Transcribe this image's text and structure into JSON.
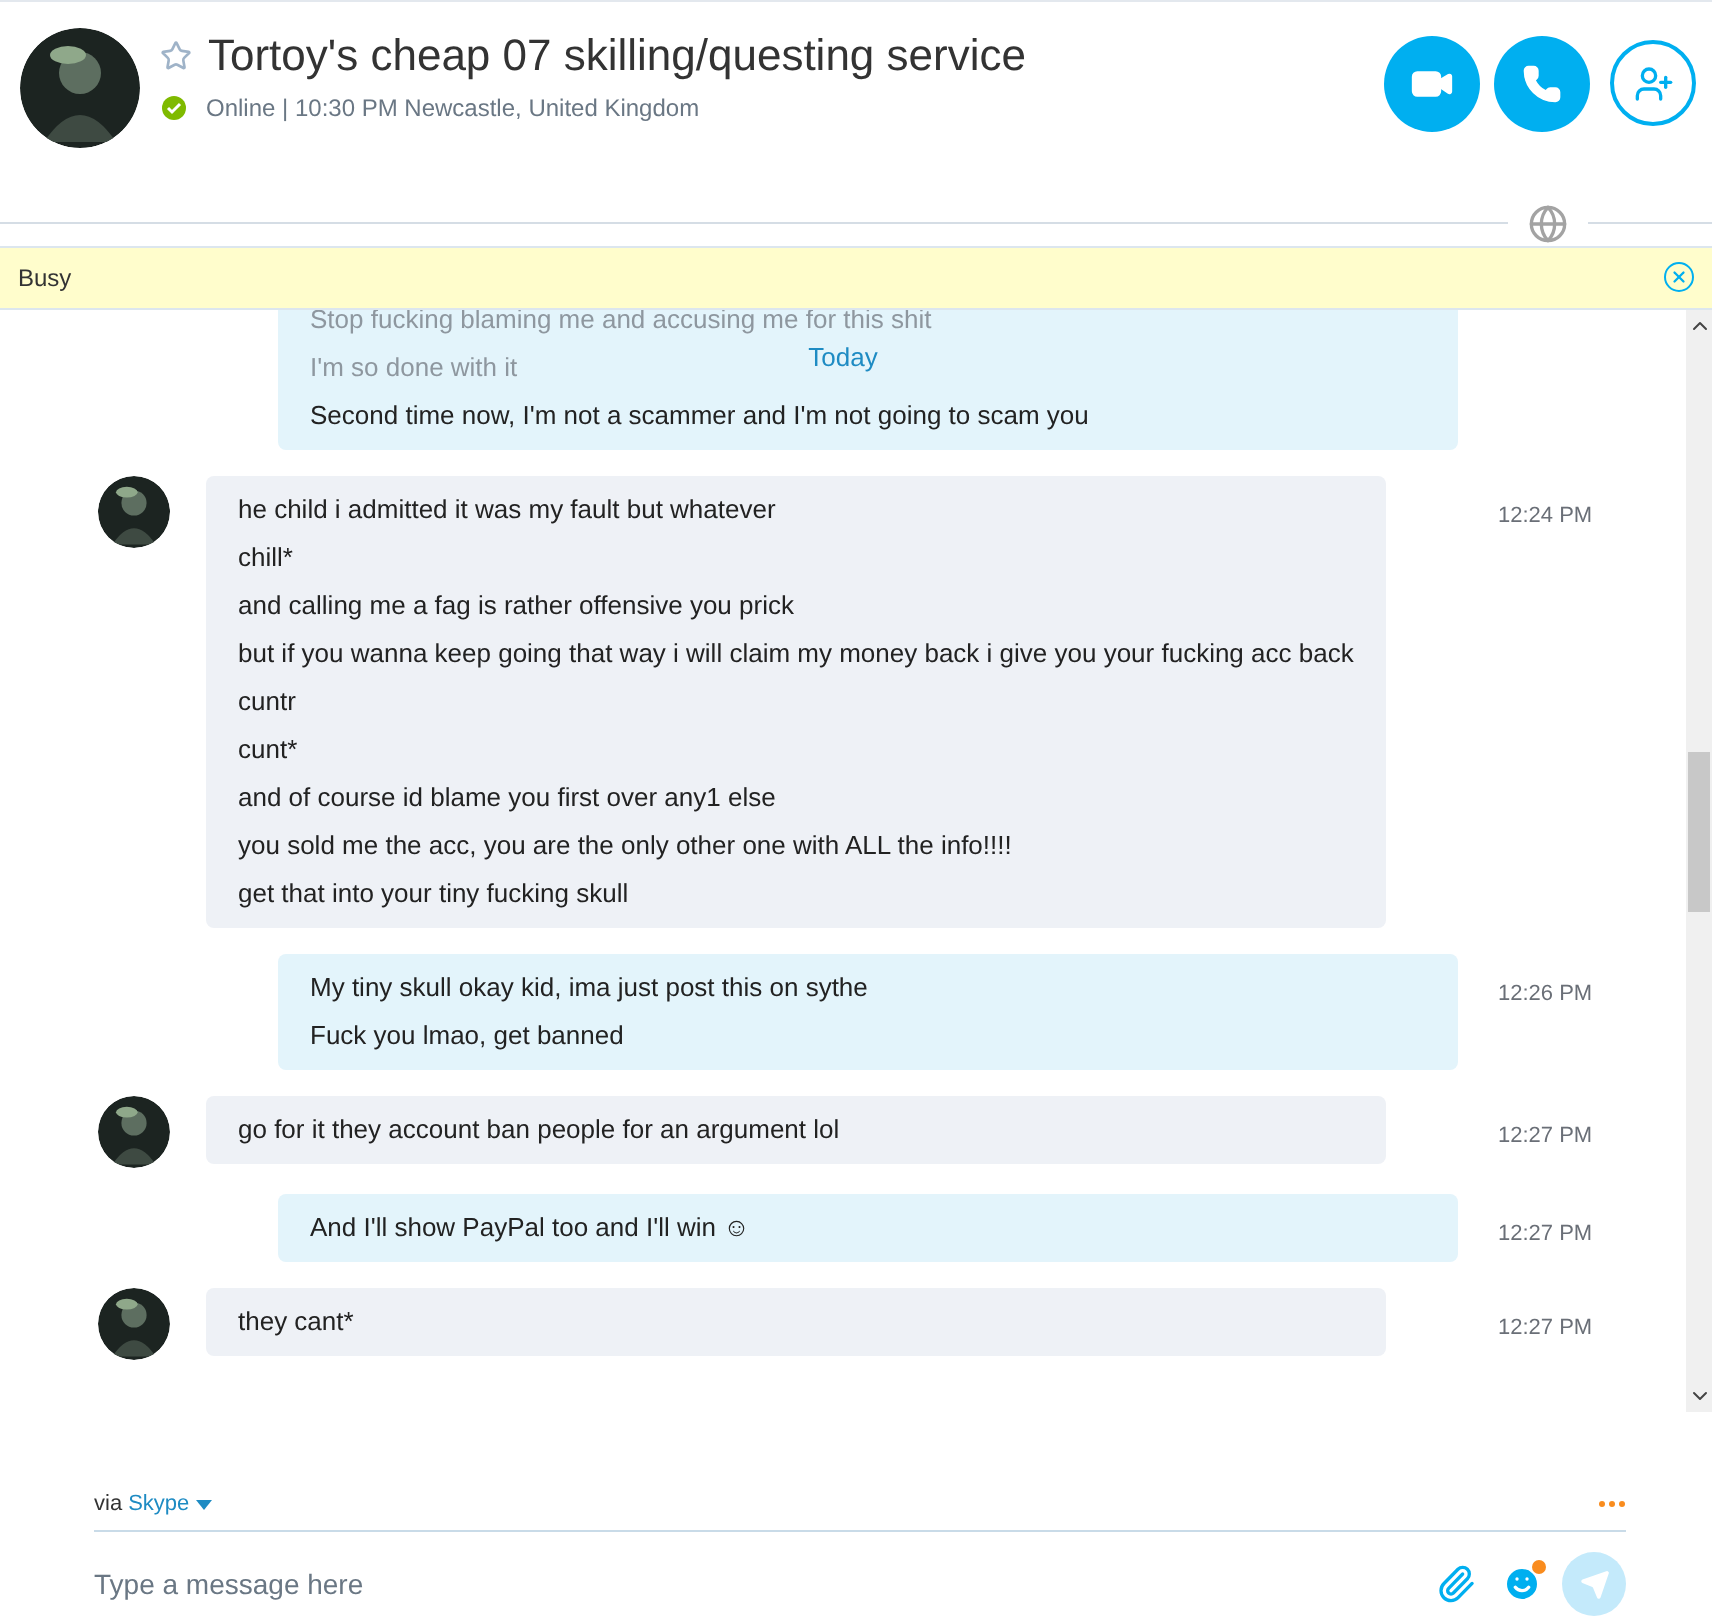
{
  "header": {
    "title": "Tortoy's cheap 07 skilling/questing service",
    "favorite": false,
    "status": "Online | 10:30 PM Newcastle, United Kingdom"
  },
  "banner": {
    "text": "Busy"
  },
  "chat": {
    "date_divider": "Today",
    "messages": [
      {
        "kind": "outgoing",
        "lines": [
          {
            "text": "Stop fucking blaming me and accusing me for this shit",
            "faded": true
          },
          {
            "text": "I'm so done with it",
            "faded": true
          },
          {
            "text": "Second time now, I'm not a scammer and I'm not going to scam you",
            "faded": false
          }
        ]
      },
      {
        "kind": "incoming",
        "time": "12:24 PM",
        "lines": [
          {
            "text": "he child i admitted it was my fault but whatever",
            "faded": false
          },
          {
            "text": "chill*",
            "faded": false
          },
          {
            "text": "and calling me a fag is rather offensive you prick",
            "faded": false
          },
          {
            "text": "but if you wanna keep going that way i will claim my money back i give you your fucking acc back",
            "faded": false
          },
          {
            "text": "cuntr",
            "faded": false
          },
          {
            "text": "cunt*",
            "faded": false
          },
          {
            "text": "and of course id blame you first over any1 else",
            "faded": false
          },
          {
            "text": "you sold me the acc, you are the only other one with ALL the info!!!!",
            "faded": false
          },
          {
            "text": "get that into your tiny fucking skull",
            "faded": false
          }
        ]
      },
      {
        "kind": "outgoing",
        "time": "12:26 PM",
        "lines": [
          {
            "text": "My tiny skull okay kid, ima just post this on sythe",
            "faded": false
          },
          {
            "text": "Fuck you lmao, get banned",
            "faded": false
          }
        ]
      },
      {
        "kind": "incoming",
        "time": "12:27 PM",
        "lines": [
          {
            "text": "go for it they account ban people for an argument lol",
            "faded": false
          }
        ]
      },
      {
        "kind": "outgoing",
        "time": "12:27 PM",
        "lines": [
          {
            "text": "And I'll show PayPal too and I'll win ☺",
            "faded": false
          }
        ]
      },
      {
        "kind": "incoming",
        "time": "12:27 PM",
        "lines": [
          {
            "text": "they cant*",
            "faded": false
          }
        ]
      }
    ]
  },
  "composer": {
    "via": "via",
    "service": "Skype",
    "placeholder": "Type a message here"
  }
}
